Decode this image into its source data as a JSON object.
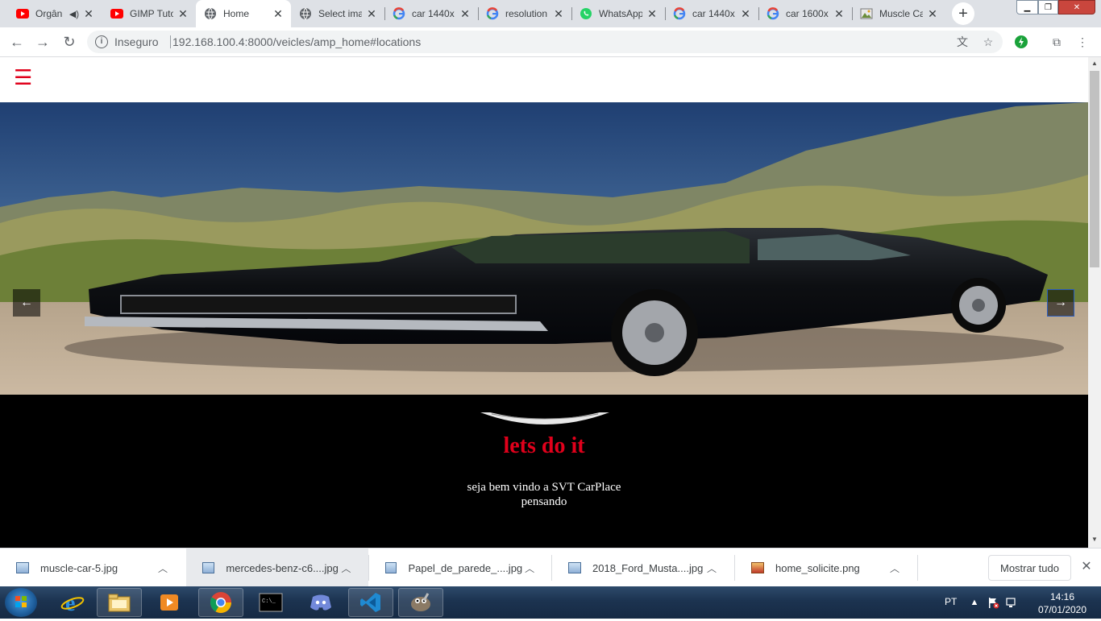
{
  "browser": {
    "tabs": [
      {
        "label": "Orgân",
        "icon": "youtube-icon",
        "audio": true
      },
      {
        "label": "GIMP Tuto",
        "icon": "youtube-icon"
      },
      {
        "label": "Home",
        "icon": "globe-icon",
        "active": true
      },
      {
        "label": "Select ima",
        "icon": "globe-icon"
      },
      {
        "label": "car 1440x",
        "icon": "google-icon"
      },
      {
        "label": "resolution",
        "icon": "google-icon"
      },
      {
        "label": "WhatsApp",
        "icon": "whatsapp-icon"
      },
      {
        "label": "car 1440x",
        "icon": "google-icon"
      },
      {
        "label": "car 1600x",
        "icon": "google-icon"
      },
      {
        "label": "Muscle Ca",
        "icon": "image-icon"
      }
    ],
    "insecure_label": "Inseguro",
    "url": "192.168.100.4:8000/veicles/amp_home#locations"
  },
  "page": {
    "slogan": "lets do it",
    "welcome_line1": "seja bem vindo a SVT CarPlace",
    "welcome_line2": "pensando",
    "colors": {
      "accent": "#e0001b",
      "dark_bg": "#000000"
    }
  },
  "downloads": {
    "items": [
      {
        "name": "muscle-car-5.jpg"
      },
      {
        "name": "mercedes-benz-c6....jpg",
        "highlighted": true
      },
      {
        "name": "Papel_de_parede_....jpg"
      },
      {
        "name": "2018_Ford_Musta....jpg"
      },
      {
        "name": "home_solicite.png"
      }
    ],
    "show_all": "Mostrar tudo"
  },
  "taskbar": {
    "apps": [
      "internet-explorer-icon",
      "file-explorer-icon",
      "media-player-icon",
      "chrome-icon",
      "cmd-icon",
      "discord-icon",
      "vscode-icon",
      "gimp-icon"
    ],
    "language": "PT",
    "time": "14:16",
    "date": "07/01/2020"
  }
}
